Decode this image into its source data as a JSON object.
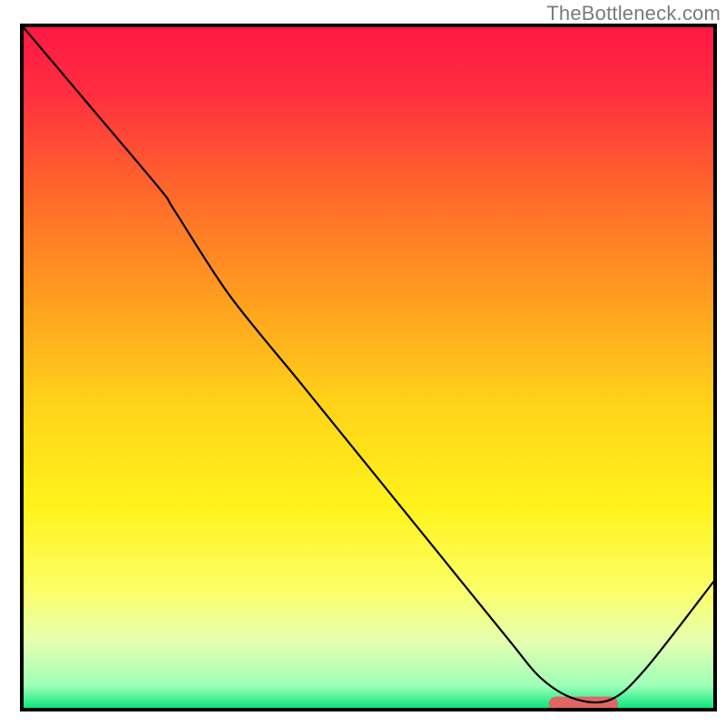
{
  "watermark": "TheBottleneck.com",
  "chart_data": {
    "type": "line",
    "title": "",
    "xlabel": "",
    "ylabel": "",
    "xlim": [
      0,
      100
    ],
    "ylim": [
      0,
      100
    ],
    "axes_visible": false,
    "grid": false,
    "background_gradient": {
      "stops": [
        {
          "offset": 0.0,
          "color": "#ff1744"
        },
        {
          "offset": 0.1,
          "color": "#ff2f3f"
        },
        {
          "offset": 0.25,
          "color": "#ff6a2a"
        },
        {
          "offset": 0.4,
          "color": "#ff9e1f"
        },
        {
          "offset": 0.55,
          "color": "#ffd21a"
        },
        {
          "offset": 0.7,
          "color": "#fff21a"
        },
        {
          "offset": 0.82,
          "color": "#fcff63"
        },
        {
          "offset": 0.9,
          "color": "#e6ffb0"
        },
        {
          "offset": 0.965,
          "color": "#9effb8"
        },
        {
          "offset": 1.0,
          "color": "#00e47a"
        }
      ]
    },
    "series": [
      {
        "name": "bottleneck-curve",
        "color": "#000000",
        "stroke_width": 2.2,
        "x": [
          0,
          10,
          20,
          22,
          30,
          40,
          50,
          60,
          70,
          75,
          80,
          85,
          90,
          100
        ],
        "values": [
          100,
          88,
          76,
          73,
          60.5,
          48,
          35.5,
          23,
          10.5,
          4.5,
          1.5,
          1.5,
          6,
          19
        ]
      }
    ],
    "marker": {
      "name": "optimal-region",
      "shape": "rounded-bar",
      "color": "#e06666",
      "x_start": 76,
      "x_end": 86,
      "y": 0.8,
      "height": 2.2
    },
    "plot_border": {
      "color": "#000000",
      "width": 4
    }
  }
}
